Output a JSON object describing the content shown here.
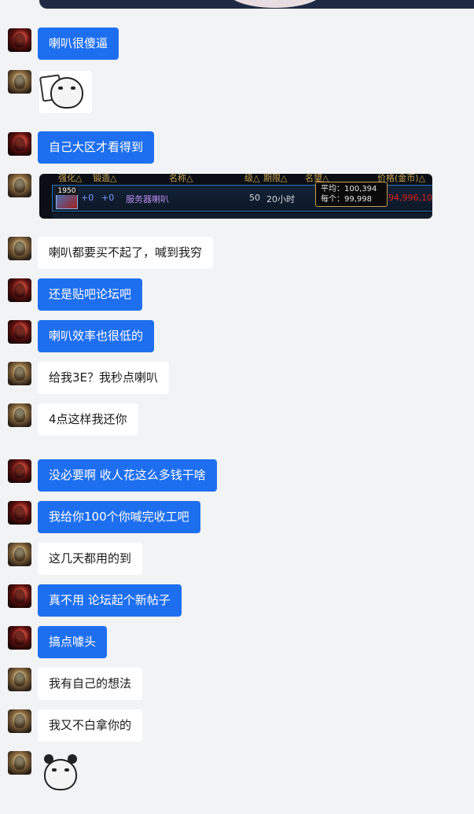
{
  "messages": [
    {
      "text": "喇叭很傻逼"
    },
    {
      "text": "自己大区才看得到"
    },
    {
      "text": "喇叭都要买不起了，喊到我穷"
    },
    {
      "text": "还是贴吧论坛吧"
    },
    {
      "text": "喇叭效率也很低的"
    },
    {
      "text": "给我3E？我秒点喇叭"
    },
    {
      "text": "4点这样我还你"
    },
    {
      "text": "没必要啊 收人花这么多钱干啥"
    },
    {
      "text": "我给你100个你喊完收工吧"
    },
    {
      "text": "这几天都用的到"
    },
    {
      "text": "真不用 论坛起个新帖子"
    },
    {
      "text": "搞点噱头"
    },
    {
      "text": "我有自己的想法"
    },
    {
      "text": "我又不白拿你的"
    }
  ],
  "game_screenshot": {
    "headers": [
      "强化△",
      "锻造△",
      "名称△",
      "级△",
      "期限△",
      "名望△",
      "价格(金币)△"
    ],
    "item_level": "1950",
    "plus1": "+0",
    "plus2": "+0",
    "item_name": "服务器喇叭",
    "level": "50",
    "duration": "20小时",
    "tooltip_avg": "平均：100,394",
    "tooltip_each": "每个：99,998",
    "price": "94,996,100"
  },
  "colors": {
    "outgoing_bubble": "#1e6ff0",
    "incoming_bubble": "#ffffff",
    "background": "#f2f3f5"
  }
}
